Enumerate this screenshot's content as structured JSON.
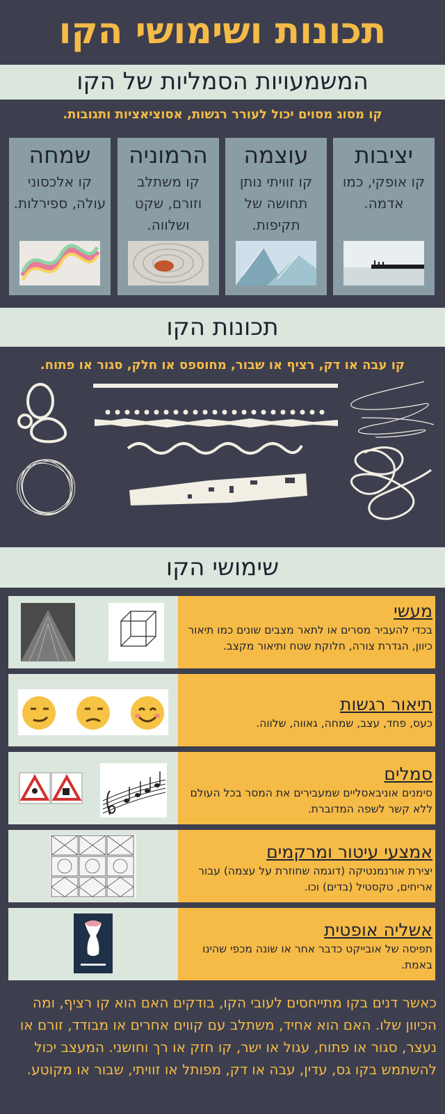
{
  "title": "תכונות ושימושי הקו",
  "section1": {
    "heading": "המשמעויות הסמליות של הקו",
    "subtitle": "קו מסוג מסוים יכול לעורר רגשות, אסוציאציות ותגובות.",
    "cards": [
      {
        "title": "יציבות",
        "text": "קו אופקי, כמו אדמה."
      },
      {
        "title": "עוצמה",
        "text": "קו זוויתי נותן תחושה של תקיפות."
      },
      {
        "title": "הרמוניה",
        "text": "קו משתלב וזורם, שקט ושלווה."
      },
      {
        "title": "שמחה",
        "text": "קו אלכסוני עולה, ספירלות."
      }
    ]
  },
  "section2": {
    "heading": "תכונות הקו",
    "subtitle": "קו עבה או דק, רציף או שבור, מחוספס או חלק, סגור או פתוח."
  },
  "section3": {
    "heading": "שימושי הקו",
    "uses": [
      {
        "title": "מעשי",
        "desc": "בכדי להעביר מסרים או לתאר מצבים שונים כמו תיאור כיוון, הגדרת צורה, חלוקת שטח ותיאור מקצב."
      },
      {
        "title": "תיאור רגשות",
        "desc": "כעס, פחד, עצב, שמחה, גאווה, שלווה."
      },
      {
        "title": "סמלים",
        "desc": "סימנים אוניבאסליים שמעבירים את המסר בכל העולם ללא קשר לשפה המדוברת."
      },
      {
        "title": "אמצעי עיטור ומרקמים",
        "desc": "יצירת אורנמנטיקה (דוגמה שחוזרת על עצמה) עבור אריחים, טקסטיל (בדים) וכו."
      },
      {
        "title": "אשליה אופטית",
        "desc": "תפיסה של אובייקט כדבר אחר או שונה מכפי שהינו באמת."
      }
    ]
  },
  "footer": "כאשר דנים בקו מתייחסים לעובי הקו, בודקים האם הוא קו רציף, ומה הכיוון שלו. האם הוא אחיד, משתלב עם קווים אחרים או מבודד, זורם או נעצר, סגור או פתוח, עגול או ישר, קו חזק או רך וחושני. המעצב יכול להשתמש בקו גס, עדין, עבה או דק, מפותל או זוויתי, שבור או מקוטע.",
  "colors": {
    "background": "#3d3f4f",
    "accent": "#f5bb46",
    "band": "#dbe6dd",
    "card": "#8a9da5"
  }
}
